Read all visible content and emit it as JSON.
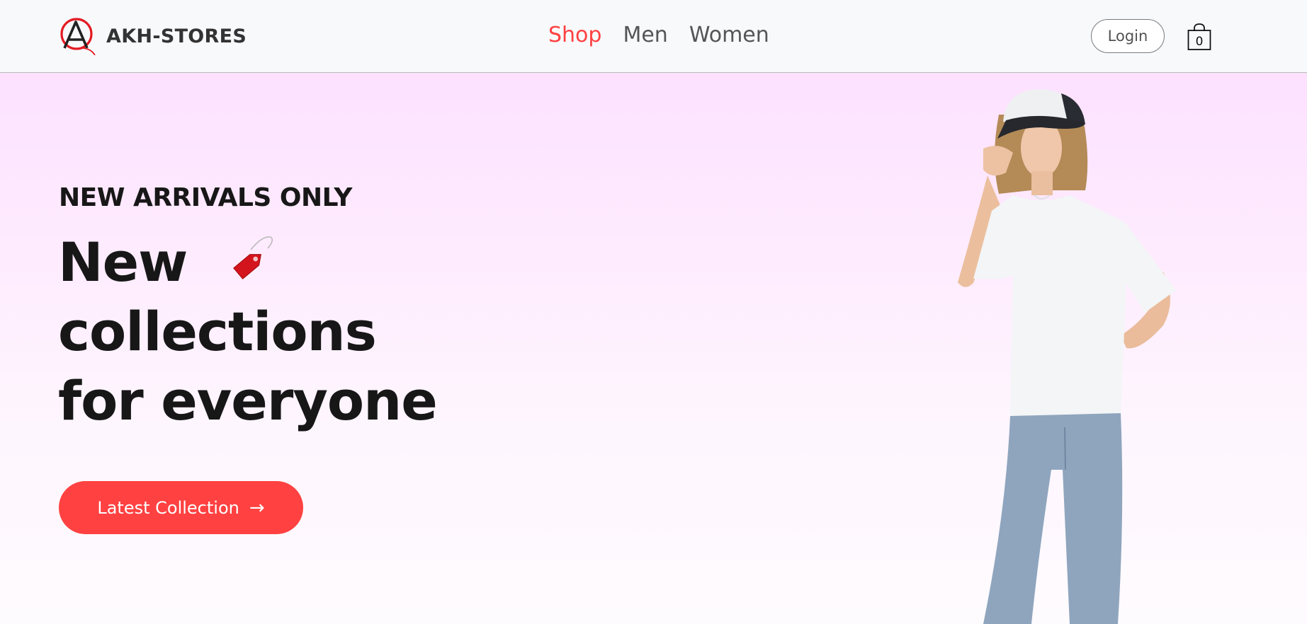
{
  "brand": {
    "name": "AKH-STORES",
    "logo_icon": "logo-a-circle-icon"
  },
  "nav": {
    "menu": [
      {
        "label": "Shop",
        "active": true
      },
      {
        "label": "Men",
        "active": false
      },
      {
        "label": "Women",
        "active": false
      }
    ],
    "login_label": "Login",
    "cart_count": "0"
  },
  "hero": {
    "tagline": "NEW ARRIVALS ONLY",
    "title_line1": "New",
    "title_line2": "collections",
    "title_line3": "for everyone",
    "cta_label": "Latest Collection",
    "cta_arrow": "→"
  },
  "colors": {
    "accent": "#ff4141",
    "hero_bg_top": "#fde1ff",
    "navbar_bg": "#f8f9fb"
  }
}
